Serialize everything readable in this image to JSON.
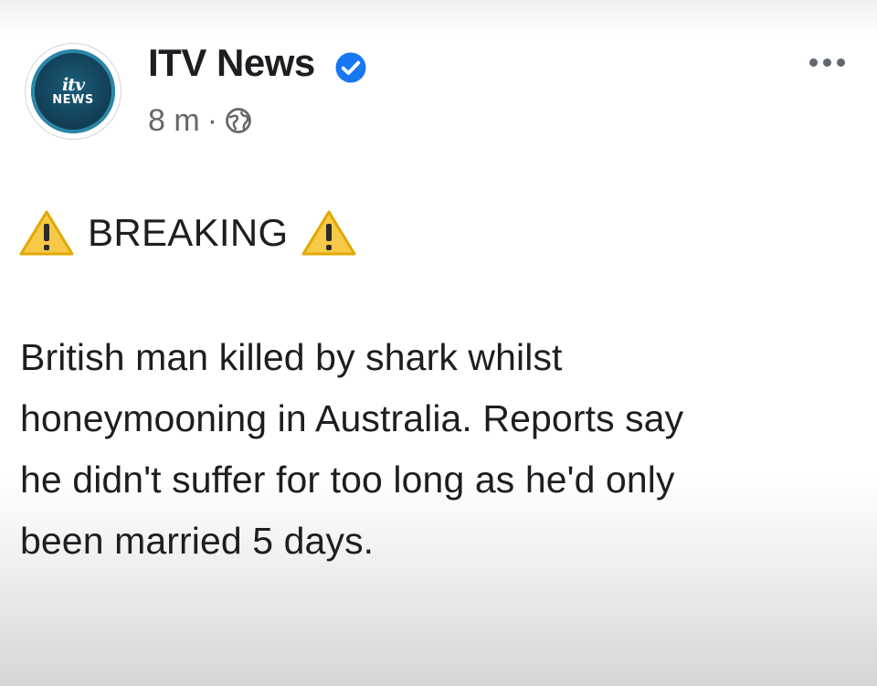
{
  "post": {
    "author": "ITV News",
    "verified": true,
    "timestamp": "8 m",
    "separator": "·",
    "audience_icon": "globe-icon",
    "logo": {
      "top": "itv",
      "bottom": "NEWS"
    },
    "breaking_label": "BREAKING",
    "warning_icon": "warning-icon",
    "body_lines": [
      "British man killed by shark whilst",
      "honeymooning in Australia. Reports say",
      "he didn't suffer for too long as he'd only",
      "been married 5 days."
    ]
  },
  "colors": {
    "logo_bg": "#123f56",
    "logo_ring": "#2b87a8",
    "verified_badge": "#1877f2",
    "warning_yellow": "#f7c948",
    "text_primary": "#1c1e21",
    "text_secondary": "#65676b"
  }
}
